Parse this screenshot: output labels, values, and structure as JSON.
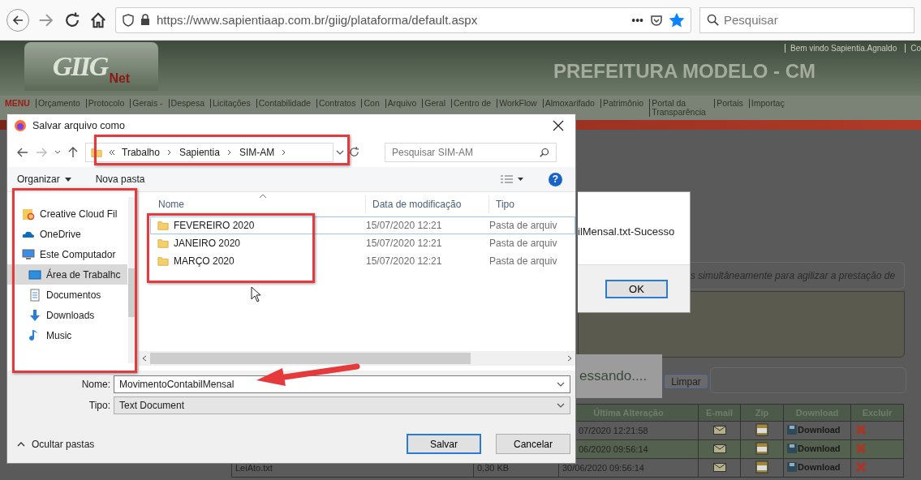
{
  "browser": {
    "url": "https://www.sapientiaap.com.br/giig/plataforma/default.aspx",
    "more": "•••",
    "bookmarked": true,
    "search": {
      "placeholder": "Pesquisar"
    }
  },
  "site": {
    "logo": "GIIG",
    "logo_sub": "Net",
    "welcome": "Bem vindo Sapientia.Agnaldo",
    "header_link": "Co",
    "title": "PREFEITURA MODELO - CM",
    "menu": [
      {
        "label": "MENU",
        "kind": "title"
      },
      {
        "label": "Orçamento",
        "kind": "item"
      },
      {
        "label": "Protocolo",
        "kind": "item"
      },
      {
        "label": "Gerais -",
        "kind": "item"
      },
      {
        "label": "Despesa",
        "kind": "item"
      },
      {
        "label": "Licitações",
        "kind": "item"
      },
      {
        "label": "Contabilidade",
        "kind": "item"
      },
      {
        "label": "Contratos",
        "kind": "item"
      },
      {
        "label": "Con",
        "kind": "item"
      },
      {
        "label": "Arquivo",
        "kind": "item"
      },
      {
        "label": "Geral",
        "kind": "item"
      },
      {
        "label": "Centro de",
        "kind": "item"
      },
      {
        "label": "WorkFlow",
        "kind": "item"
      },
      {
        "label": "Almoxarifado",
        "kind": "item"
      },
      {
        "label": "Patrimônio",
        "kind": "item"
      },
      {
        "label": "Portal da Transparência",
        "kind": "item"
      },
      {
        "label": "Portais",
        "kind": "item"
      },
      {
        "label": "Importaç",
        "kind": "item"
      }
    ]
  },
  "alert": {
    "message": "ilMensal.txt-Sucesso",
    "ok": "OK"
  },
  "notice": "s simultâneamente para agilizar a prestação de",
  "processing": "essando....",
  "clear_button": "Limpar",
  "table": {
    "columns": [
      "Última Alteração",
      "E-mail",
      "Zip",
      "Download",
      "Excluir"
    ],
    "rows": [
      {
        "date": "07/2020 12:21:58",
        "download": "Download"
      },
      {
        "date": "06/2020 09:56:14",
        "download": "Download"
      },
      {
        "name": "LeiAto.txt",
        "size": "0,30 KB",
        "date": "30/06/2020 09:56:14",
        "download": "Download"
      }
    ]
  },
  "dialog": {
    "title": "Salvar arquivo como",
    "path": [
      "Trabalho",
      "Sapientia",
      "SIM-AM"
    ],
    "search": {
      "placeholder": "Pesquisar SIM-AM"
    },
    "organize": "Organizar",
    "new_folder": "Nova pasta",
    "help": "?",
    "nav": [
      {
        "label": "Creative Cloud Fil",
        "kind": "cloud-files",
        "selected": false
      },
      {
        "label": "OneDrive",
        "kind": "onedrive",
        "selected": false
      },
      {
        "label": "Este Computador",
        "kind": "computer",
        "selected": false
      },
      {
        "label": "Área de Trabalhc",
        "kind": "desktop",
        "selected": true
      },
      {
        "label": "Documentos",
        "kind": "documents",
        "selected": false
      },
      {
        "label": "Downloads",
        "kind": "downloads",
        "selected": false
      },
      {
        "label": "Music",
        "kind": "music",
        "selected": false
      }
    ],
    "columns": [
      "Nome",
      "Data de modificação",
      "Tipo"
    ],
    "files": [
      {
        "name": "FEVEREIRO 2020",
        "modified": "15/07/2020 12:21",
        "type": "Pasta de arquiv",
        "focused": true
      },
      {
        "name": "JANEIRO 2020",
        "modified": "15/07/2020 12:21",
        "type": "Pasta de arquiv",
        "focused": false
      },
      {
        "name": "MARÇO 2020",
        "modified": "15/07/2020 12:21",
        "type": "Pasta de arquiv",
        "focused": false
      }
    ],
    "name_label": "Nome:",
    "name_value": "MovimentoContabilMensal",
    "type_label": "Tipo:",
    "type_value": "Text Document",
    "hide_folders": "Ocultar pastas",
    "save": "Salvar",
    "cancel": "Cancelar"
  }
}
